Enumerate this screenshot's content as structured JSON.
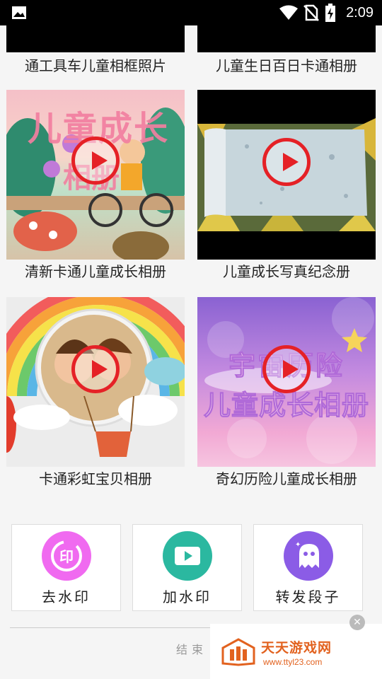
{
  "status_bar": {
    "time": "2:09",
    "left_icon": "image-icon",
    "icons": [
      "wifi-icon",
      "no-sim-icon",
      "battery-charging-icon"
    ]
  },
  "templates": [
    {
      "title": "通工具车儿童相框照片"
    },
    {
      "title": "儿童生日百日卡通相册"
    },
    {
      "title": "清新卡通儿童成长相册",
      "overlay": "儿童成长\n相册"
    },
    {
      "title": "儿童成长写真纪念册"
    },
    {
      "title": "卡通彩虹宝贝相册"
    },
    {
      "title": "奇幻历险儿童成长相册",
      "overlay_line1": "宇宙历险",
      "overlay_line2": "儿童成长相册"
    }
  ],
  "tools": [
    {
      "label": "去水印",
      "icon": "remove-watermark-icon",
      "color": "#f06af0"
    },
    {
      "label": "加水印",
      "icon": "add-watermark-icon",
      "color": "#2bb8a0"
    },
    {
      "label": "转发段子",
      "icon": "ghost-icon",
      "color": "#8b5ce6"
    }
  ],
  "footer": {
    "end_text": "结束"
  },
  "ad": {
    "title": "天天游戏网",
    "url": "www.ttyl23.com",
    "brand_color": "#e2621f"
  }
}
